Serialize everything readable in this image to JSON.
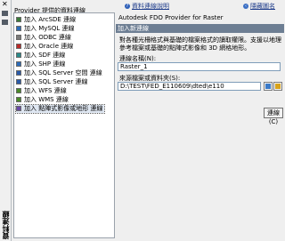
{
  "palette": {
    "vertical_title": "資料連線"
  },
  "header": {
    "provider_label": "Provider 提供的資料連線",
    "help_link": "資料連線說明",
    "toggle_link": "隱藏圖名"
  },
  "providers": [
    {
      "label": "加入 ArcSDE 連線",
      "icon": "arcsde-icon"
    },
    {
      "label": "加入 MySQL 連線",
      "icon": "mysql-icon"
    },
    {
      "label": "加入 ODBC 連線",
      "icon": "odbc-icon"
    },
    {
      "label": "加入 Oracle 連線",
      "icon": "oracle-icon"
    },
    {
      "label": "加入 SDF 連線",
      "icon": "sdf-icon"
    },
    {
      "label": "加入 SHP 連線",
      "icon": "shp-icon"
    },
    {
      "label": "加入 SQL Server 空間 連線",
      "icon": "sqlserver-spatial-icon"
    },
    {
      "label": "加入 SQL Server 連線",
      "icon": "sqlserver-icon"
    },
    {
      "label": "加入 WFS 連線",
      "icon": "wfs-icon"
    },
    {
      "label": "加入 WMS 連線",
      "icon": "wms-icon"
    },
    {
      "label": "加入 點陣式影像或地形 連線",
      "icon": "raster-icon",
      "selected": true
    }
  ],
  "details": {
    "title": "Autodesk FDO Provider for Raster",
    "section": "加入新連線",
    "description": "對各種光柵格式與基礎的檔案格式的讀取權限。支援以地理參考檔案或基礎的點陣式影像和 3D 網格地形。",
    "name_label": "連線名稱(N):",
    "name_value": "Raster_1",
    "path_label": "來源檔案或資料夾(S):",
    "path_value": "D:\\TEST\\FED_E110609\\dted\\e110",
    "connect_label": "連線(C)"
  }
}
